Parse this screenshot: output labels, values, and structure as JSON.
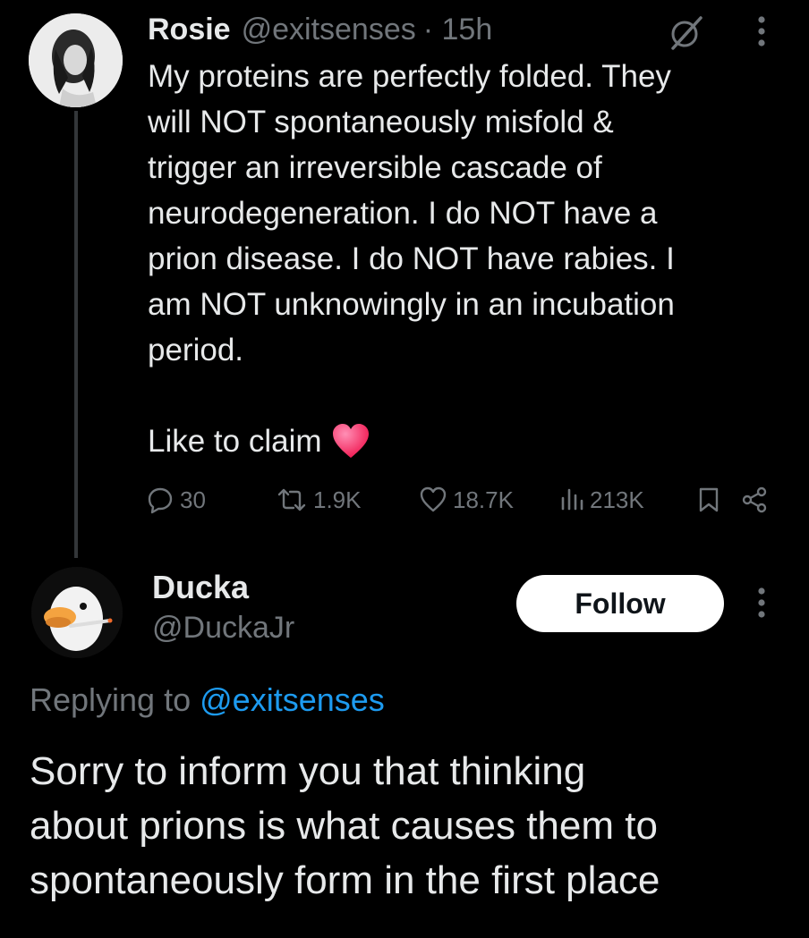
{
  "tweet1": {
    "name": "Rosie",
    "handle": "@exitsenses",
    "time": "· 15h",
    "body_lines": [
      "My proteins are perfectly folded. They",
      "will NOT spontaneously misfold &",
      "trigger an irreversible cascade of",
      "neurodegeneration. I do NOT have a",
      "prion disease. I do NOT have rabies. I",
      "am NOT unknowingly in an incubation",
      "period."
    ],
    "claim_text": "Like to claim",
    "claim_emoji": "heart-icon",
    "actions": {
      "replies": "30",
      "retweets": "1.9K",
      "likes": "18.7K",
      "views": "213K"
    },
    "icons": {
      "grok": "slashed-circle-icon",
      "more": "vertical-ellipsis-icon",
      "reply": "speech-bubble-icon",
      "retweet": "retweet-icon",
      "like": "heart-outline-icon",
      "views": "bar-chart-icon",
      "bookmark": "bookmark-icon",
      "share": "share-icon"
    }
  },
  "tweet2": {
    "name": "Ducka",
    "handle": "@DuckaJr",
    "follow_label": "Follow",
    "replying_prefix": "Replying to",
    "replying_mention": "@exitsenses",
    "body_lines": [
      "Sorry to inform you that thinking",
      "about prions is what causes them to",
      "spontaneously form in the first place"
    ]
  },
  "colors": {
    "background": "#000000",
    "text": "#e7e9ea",
    "muted": "#71767b",
    "link": "#1d9bf0",
    "heart": "#f91880",
    "thread_line": "#333639"
  }
}
